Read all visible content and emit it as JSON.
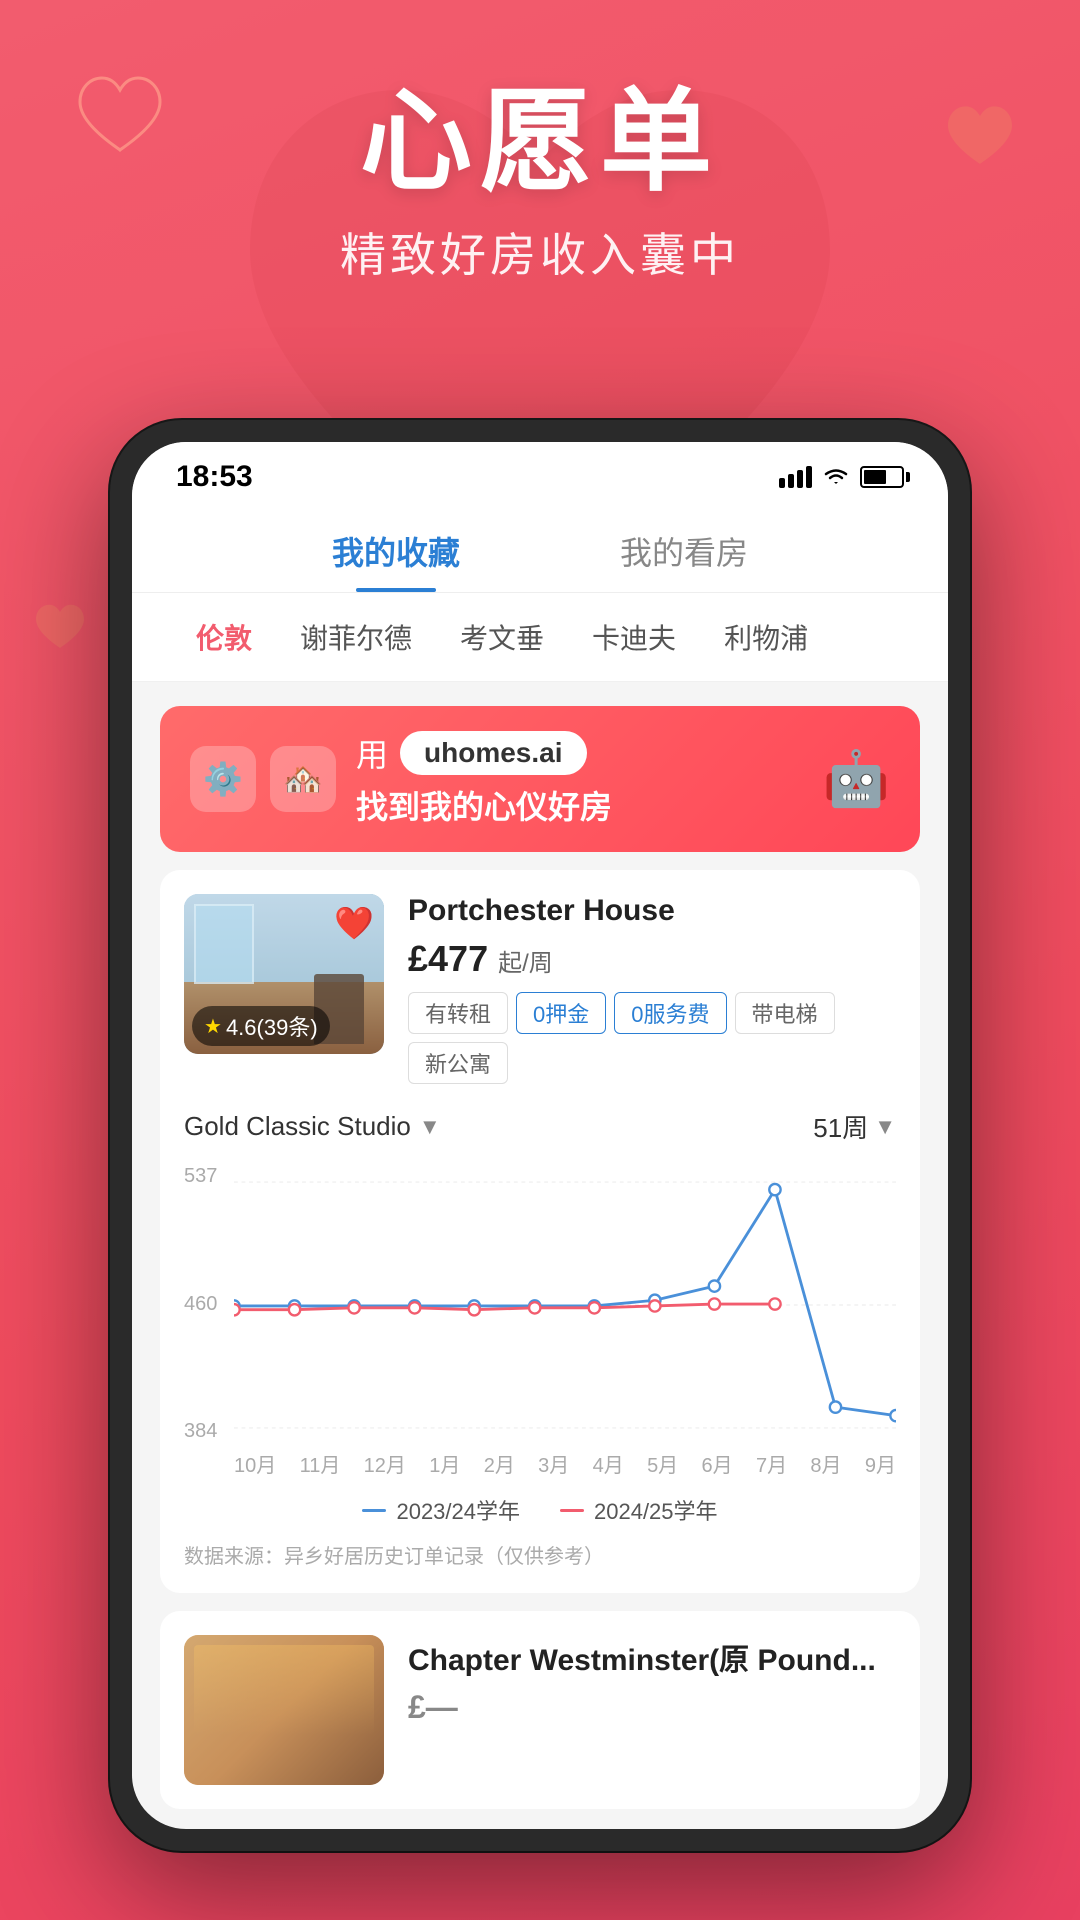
{
  "app": {
    "title_main": "心愿单",
    "title_sub": "精致好房收入囊中"
  },
  "status_bar": {
    "time": "18:53"
  },
  "tabs": [
    {
      "id": "favorites",
      "label": "我的收藏",
      "active": true
    },
    {
      "id": "viewings",
      "label": "我的看房",
      "active": false
    }
  ],
  "cities": [
    {
      "id": "london",
      "label": "伦敦",
      "active": true
    },
    {
      "id": "sheffield",
      "label": "谢菲尔德",
      "active": false
    },
    {
      "id": "coventry",
      "label": "考文垂",
      "active": false
    },
    {
      "id": "cardiff",
      "label": "卡迪夫",
      "active": false
    },
    {
      "id": "liverpool",
      "label": "利物浦",
      "active": false
    }
  ],
  "banner": {
    "prefix": "用",
    "url": "uhomes.ai",
    "suffix": "找到我的心仪好房"
  },
  "property1": {
    "name": "Portchester House",
    "price": "£477",
    "price_unit": "起/周",
    "rating": "4.6(39条)",
    "tags": [
      {
        "label": "有转租",
        "type": "gray"
      },
      {
        "label": "0押金",
        "type": "blue"
      },
      {
        "label": "0服务费",
        "type": "blue"
      },
      {
        "label": "带电梯",
        "type": "gray"
      },
      {
        "label": "新公寓",
        "type": "gray"
      }
    ]
  },
  "chart": {
    "room_type": "Gold Classic Studio",
    "period": "51周",
    "y_labels": [
      "537",
      "460",
      "384"
    ],
    "x_labels": [
      "10月",
      "11月",
      "12月",
      "1月",
      "2月",
      "3月",
      "4月",
      "5月",
      "6月",
      "7月",
      "8月",
      "9月"
    ],
    "legend": [
      {
        "label": "2023/24学年",
        "color": "#4A90D9"
      },
      {
        "label": "2024/25学年",
        "color": "#F25C6E"
      }
    ],
    "note": "数据来源：异乡好居历史订单记录（仅供参考）"
  },
  "property2": {
    "name": "Chapter Westminster(原 Pound..."
  }
}
